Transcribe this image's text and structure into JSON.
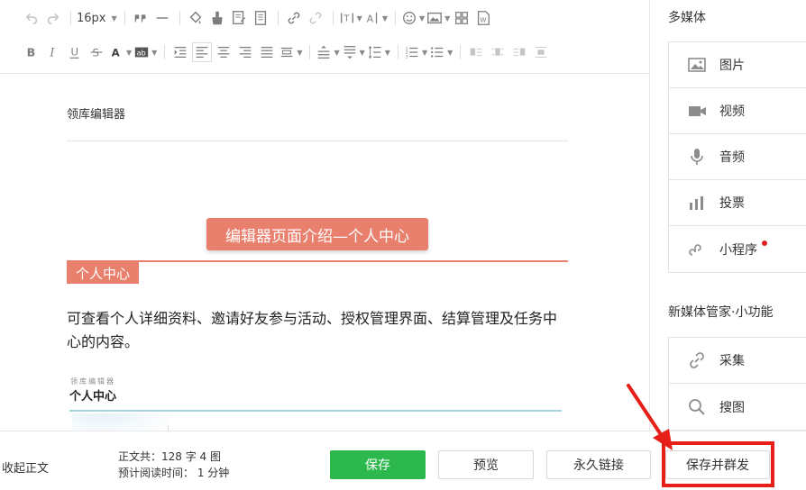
{
  "toolbar": {
    "font_size": "16px"
  },
  "editor": {
    "brand": "领库编辑器",
    "title_pill": "编辑器页面介绍—个人中心",
    "section_tag": "个人中心",
    "paragraph": "可查看个人详细资料、邀请好友参与活动、授权管理界面、结算管理及任务中心的内容。",
    "thumb_small": "领库编辑器",
    "thumb_title": "个人中心"
  },
  "sidebar": {
    "media_heading": "多媒体",
    "media_items": [
      {
        "label": "图片",
        "icon": "image-icon"
      },
      {
        "label": "视频",
        "icon": "video-icon"
      },
      {
        "label": "音频",
        "icon": "microphone-icon"
      },
      {
        "label": "投票",
        "icon": "bar-chart-icon"
      },
      {
        "label": "小程序",
        "icon": "mini-program-icon"
      }
    ],
    "tools_heading": "新媒体管家·小功能",
    "tool_items": [
      {
        "label": "采集",
        "icon": "link-rings-icon"
      },
      {
        "label": "搜图",
        "icon": "search-icon"
      }
    ]
  },
  "footer": {
    "collapse": "收起正文",
    "stats_line1": "正文共：128 字 4 图",
    "stats_line2": "预计阅读时间： 1 分钟",
    "save": "保存",
    "preview": "预览",
    "permalink": "永久链接",
    "save_mass_send": "保存并群发"
  },
  "colors": {
    "accent_salmon": "#e9806e",
    "save_green": "#2db84d",
    "highlight_red": "#e61f19"
  }
}
